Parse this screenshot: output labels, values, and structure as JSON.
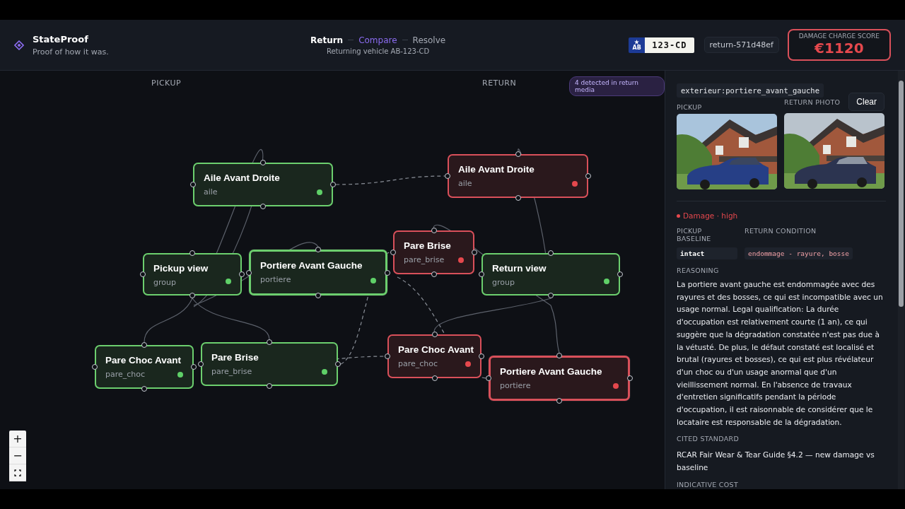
{
  "brand": {
    "name": "StateProof",
    "tagline": "Proof of how it was."
  },
  "steps": [
    {
      "label": "Return",
      "selected": false,
      "completed": true
    },
    {
      "label": "Compare",
      "selected": true,
      "completed": false
    },
    {
      "label": "Resolve",
      "selected": false,
      "completed": false
    }
  ],
  "subtitle": "Returning vehicle AB-123-CD",
  "plate": {
    "region": "AB",
    "number": "123-CD"
  },
  "session": "return-571d48ef",
  "score": {
    "label": "DAMAGE CHARGE SCORE",
    "value": "€1120"
  },
  "canvas": {
    "columns": [
      "PICKUP",
      "RETURN"
    ],
    "badge": "4 detected in return media",
    "nodes": [
      {
        "title": "Aile Avant Droite",
        "type": "aile",
        "damaged": false,
        "selected": false
      },
      {
        "title": "Pickup view",
        "type": "group",
        "damaged": false,
        "selected": false
      },
      {
        "title": "Portiere Avant Gauche",
        "type": "portiere",
        "damaged": false,
        "selected": true
      },
      {
        "title": "Pare Choc Avant",
        "type": "pare_choc",
        "damaged": false,
        "selected": false
      },
      {
        "title": "Pare Brise",
        "type": "pare_brise",
        "damaged": false,
        "selected": false
      },
      {
        "title": "Aile Avant Droite",
        "type": "aile",
        "damaged": true,
        "selected": false
      },
      {
        "title": "Pare Brise",
        "type": "pare_brise",
        "damaged": true,
        "selected": false
      },
      {
        "title": "Return view",
        "type": "group",
        "damaged": false,
        "selected": false
      },
      {
        "title": "Pare Choc Avant",
        "type": "pare_choc",
        "damaged": true,
        "selected": false
      },
      {
        "title": "Portiere Avant Gauche",
        "type": "portiere",
        "damaged": true,
        "selected": true
      }
    ],
    "zoom_controls": [
      "+",
      "−"
    ]
  },
  "panel": {
    "key": "exterieur:portiere_avant_gauche",
    "pickup_label": "PICKUP",
    "return_label": "RETURN PHOTO",
    "clear": "Clear",
    "verdict": {
      "text": "Damage · high",
      "color": "#e5484d"
    },
    "baseline_label": "PICKUP BASELINE",
    "baseline": "intact",
    "condition_label": "RETURN CONDITION",
    "condition": "endommage - rayure, bosse",
    "reasoning_label": "REASONING",
    "reasoning": "La portiere avant gauche est endommagée avec des rayures et des bosses, ce qui est incompatible avec un usage normal. Legal qualification: La durée d'occupation est relativement courte (1 an), ce qui suggère que la dégradation constatée n'est pas due à la vétusté. De plus, le défaut constaté est localisé et brutal (rayures et bosses), ce qui est plus révélateur d'un choc ou d'un usage anormal que d'un vieillissement normal. En l'absence de travaux d'entretien significatifs pendant la période d'occupation, il est raisonnable de considérer que le locataire est responsable de la dégradation.",
    "standard_label": "CITED STANDARD",
    "standard": "RCAR Fair Wear & Tear Guide §4.2 — new damage vs baseline",
    "cost_label": "INDICATIVE COST"
  }
}
